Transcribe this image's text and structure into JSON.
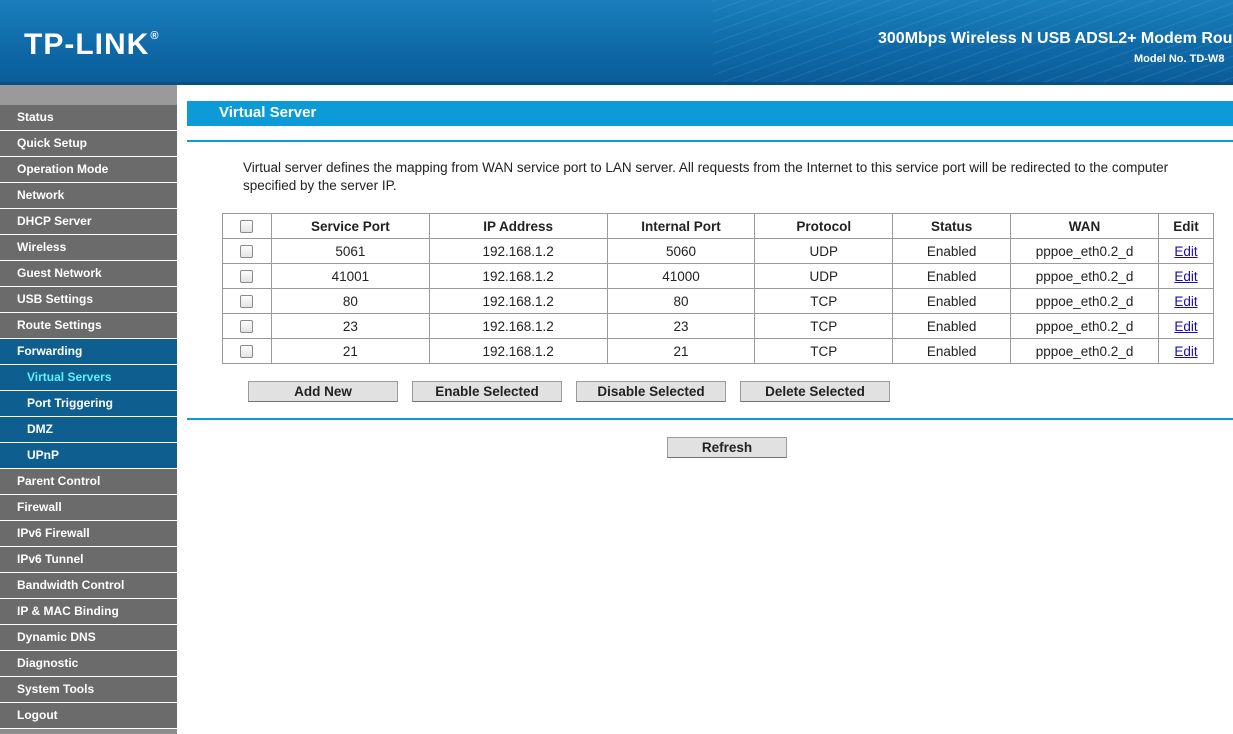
{
  "header": {
    "logo": "TP-LINK",
    "logo_reg": "®",
    "product_name": "300Mbps Wireless N USB ADSL2+ Modem Rou",
    "model_no": "Model No. TD-W8"
  },
  "sidebar": {
    "items": [
      {
        "label": "Status"
      },
      {
        "label": "Quick Setup"
      },
      {
        "label": "Operation Mode"
      },
      {
        "label": "Network"
      },
      {
        "label": "DHCP Server"
      },
      {
        "label": "Wireless"
      },
      {
        "label": "Guest Network"
      },
      {
        "label": "USB Settings"
      },
      {
        "label": "Route Settings"
      },
      {
        "label": "Forwarding"
      },
      {
        "label": "Virtual Servers"
      },
      {
        "label": "Port Triggering"
      },
      {
        "label": "DMZ"
      },
      {
        "label": "UPnP"
      },
      {
        "label": "Parent Control"
      },
      {
        "label": "Firewall"
      },
      {
        "label": "IPv6 Firewall"
      },
      {
        "label": "IPv6 Tunnel"
      },
      {
        "label": "Bandwidth Control"
      },
      {
        "label": "IP & MAC Binding"
      },
      {
        "label": "Dynamic DNS"
      },
      {
        "label": "Diagnostic"
      },
      {
        "label": "System Tools"
      },
      {
        "label": "Logout"
      }
    ]
  },
  "main": {
    "title": "Virtual Server",
    "description": "Virtual server defines the mapping from WAN service port to LAN server. All requests from the Internet to this service port will be redirected to the computer specified by the server IP.",
    "table": {
      "headers": [
        "Service Port",
        "IP Address",
        "Internal Port",
        "Protocol",
        "Status",
        "WAN",
        "Edit"
      ],
      "rows": [
        {
          "service_port": "5061",
          "ip": "192.168.1.2",
          "internal_port": "5060",
          "protocol": "UDP",
          "status": "Enabled",
          "wan": "pppoe_eth0.2_d",
          "edit": "Edit"
        },
        {
          "service_port": "41001",
          "ip": "192.168.1.2",
          "internal_port": "41000",
          "protocol": "UDP",
          "status": "Enabled",
          "wan": "pppoe_eth0.2_d",
          "edit": "Edit"
        },
        {
          "service_port": "80",
          "ip": "192.168.1.2",
          "internal_port": "80",
          "protocol": "TCP",
          "status": "Enabled",
          "wan": "pppoe_eth0.2_d",
          "edit": "Edit"
        },
        {
          "service_port": "23",
          "ip": "192.168.1.2",
          "internal_port": "23",
          "protocol": "TCP",
          "status": "Enabled",
          "wan": "pppoe_eth0.2_d",
          "edit": "Edit"
        },
        {
          "service_port": "21",
          "ip": "192.168.1.2",
          "internal_port": "21",
          "protocol": "TCP",
          "status": "Enabled",
          "wan": "pppoe_eth0.2_d",
          "edit": "Edit"
        }
      ]
    },
    "buttons": {
      "add_new": "Add New",
      "enable_selected": "Enable Selected",
      "disable_selected": "Disable Selected",
      "delete_selected": "Delete Selected",
      "refresh": "Refresh"
    }
  },
  "colors": {
    "header_blue": "#0f6aa8",
    "title_bar_blue": "#0c9bd6",
    "menu_gray": "#6b6b6b",
    "menu_active": "#0e5f90",
    "submenu_current_text": "#5ff0ff"
  }
}
